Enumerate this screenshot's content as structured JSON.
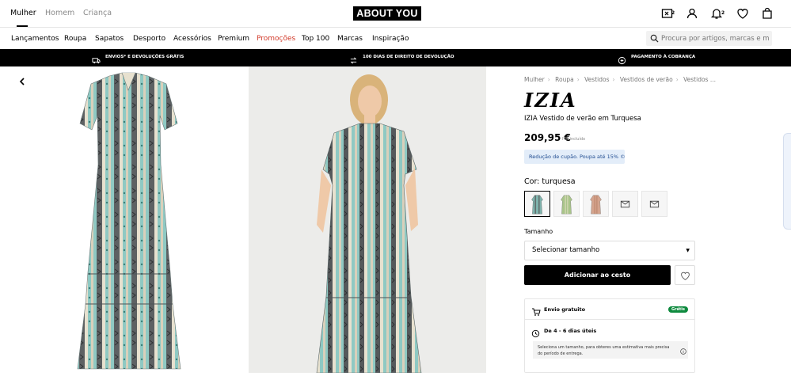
{
  "gender_tabs": [
    "Mulher",
    "Homem",
    "Criança"
  ],
  "logo": "ABOUT YOU",
  "header_icons": {
    "compare_badge": "2",
    "notifications_badge": "2"
  },
  "nav": [
    "Lançamentos",
    "Roupa",
    "Sapatos",
    "Desporto",
    "Acessórios",
    "Premium",
    "Promoções",
    "Top 100",
    "Marcas",
    "Inspiração"
  ],
  "search": {
    "placeholder": "Procura por artigos, marcas e m..."
  },
  "promo_bar": [
    "ENVIOS* E DEVOLUÇÕES GRÁTIS",
    "100 DIAS DE DIREITO DE DEVOLUÇÃO",
    "PAGAMENTO À COBRANÇA"
  ],
  "breadcrumbs": [
    "Mulher",
    "Roupa",
    "Vestidos",
    "Vestidos de verão",
    "Vestidos ..."
  ],
  "product": {
    "brand": "IZIA",
    "name": "IZIA Vestido de verão em Turquesa",
    "price": "209,95 €",
    "vat": "IVA incluído",
    "coupon": "Redução de cupão. Poupa até 15% ©",
    "color_label": "Cor:",
    "color_value": "turquesa",
    "size_label": "Tamanho",
    "size_select": "Selecionar tamanho",
    "add_button": "Adicionar ao cesto"
  },
  "shipping": {
    "label": "Envio gratuito",
    "badge": "Grátis",
    "delivery": "De 4 - 6 dias úteis",
    "note": "Seleciona um tamanho, para obteres uma estimativa mais precisa do período de entrega."
  },
  "colors": {
    "accent_promo": "#d23a2a",
    "coupon_bg": "#e3edf9",
    "badge_green": "#0e8a3e",
    "dress_turquoise": "#8fc9c3"
  }
}
